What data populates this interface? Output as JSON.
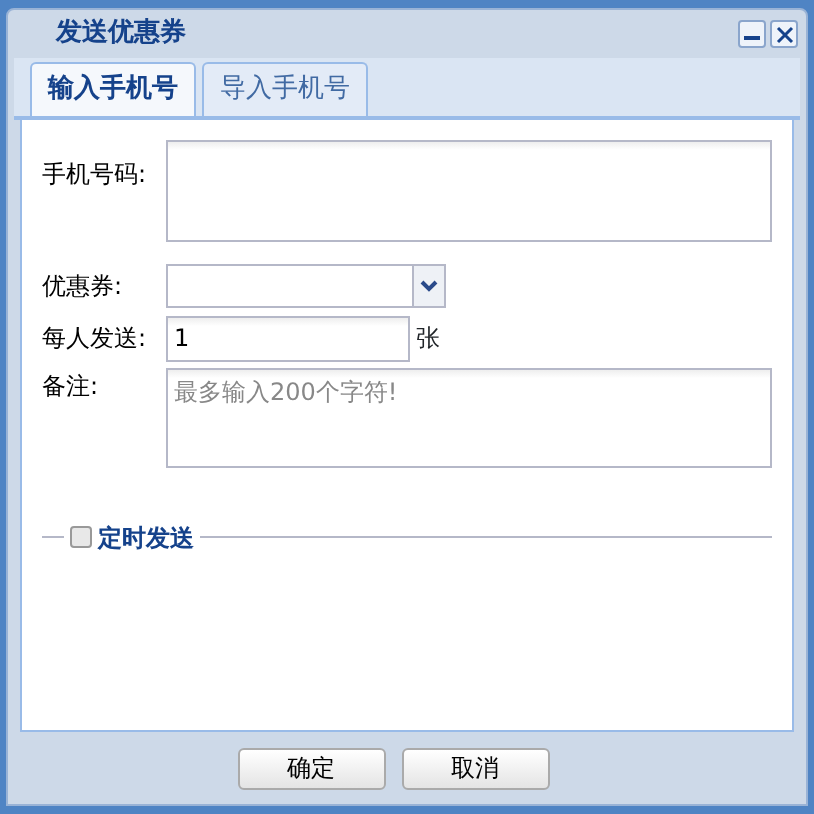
{
  "window": {
    "title": "发送优惠券"
  },
  "tabs": [
    {
      "label": "输入手机号",
      "selected": true
    },
    {
      "label": "导入手机号",
      "selected": false
    }
  ],
  "form": {
    "phone": {
      "label": "手机号码:"
    },
    "coupon": {
      "label": "优惠券:"
    },
    "per_person": {
      "label": "每人发送:",
      "value": "1",
      "unit": "张"
    },
    "note": {
      "label": "备注:",
      "placeholder": "最多输入200个字符!"
    }
  },
  "schedule": {
    "label": "定时发送",
    "checked": false
  },
  "buttons": [
    "确定",
    "取消"
  ]
}
